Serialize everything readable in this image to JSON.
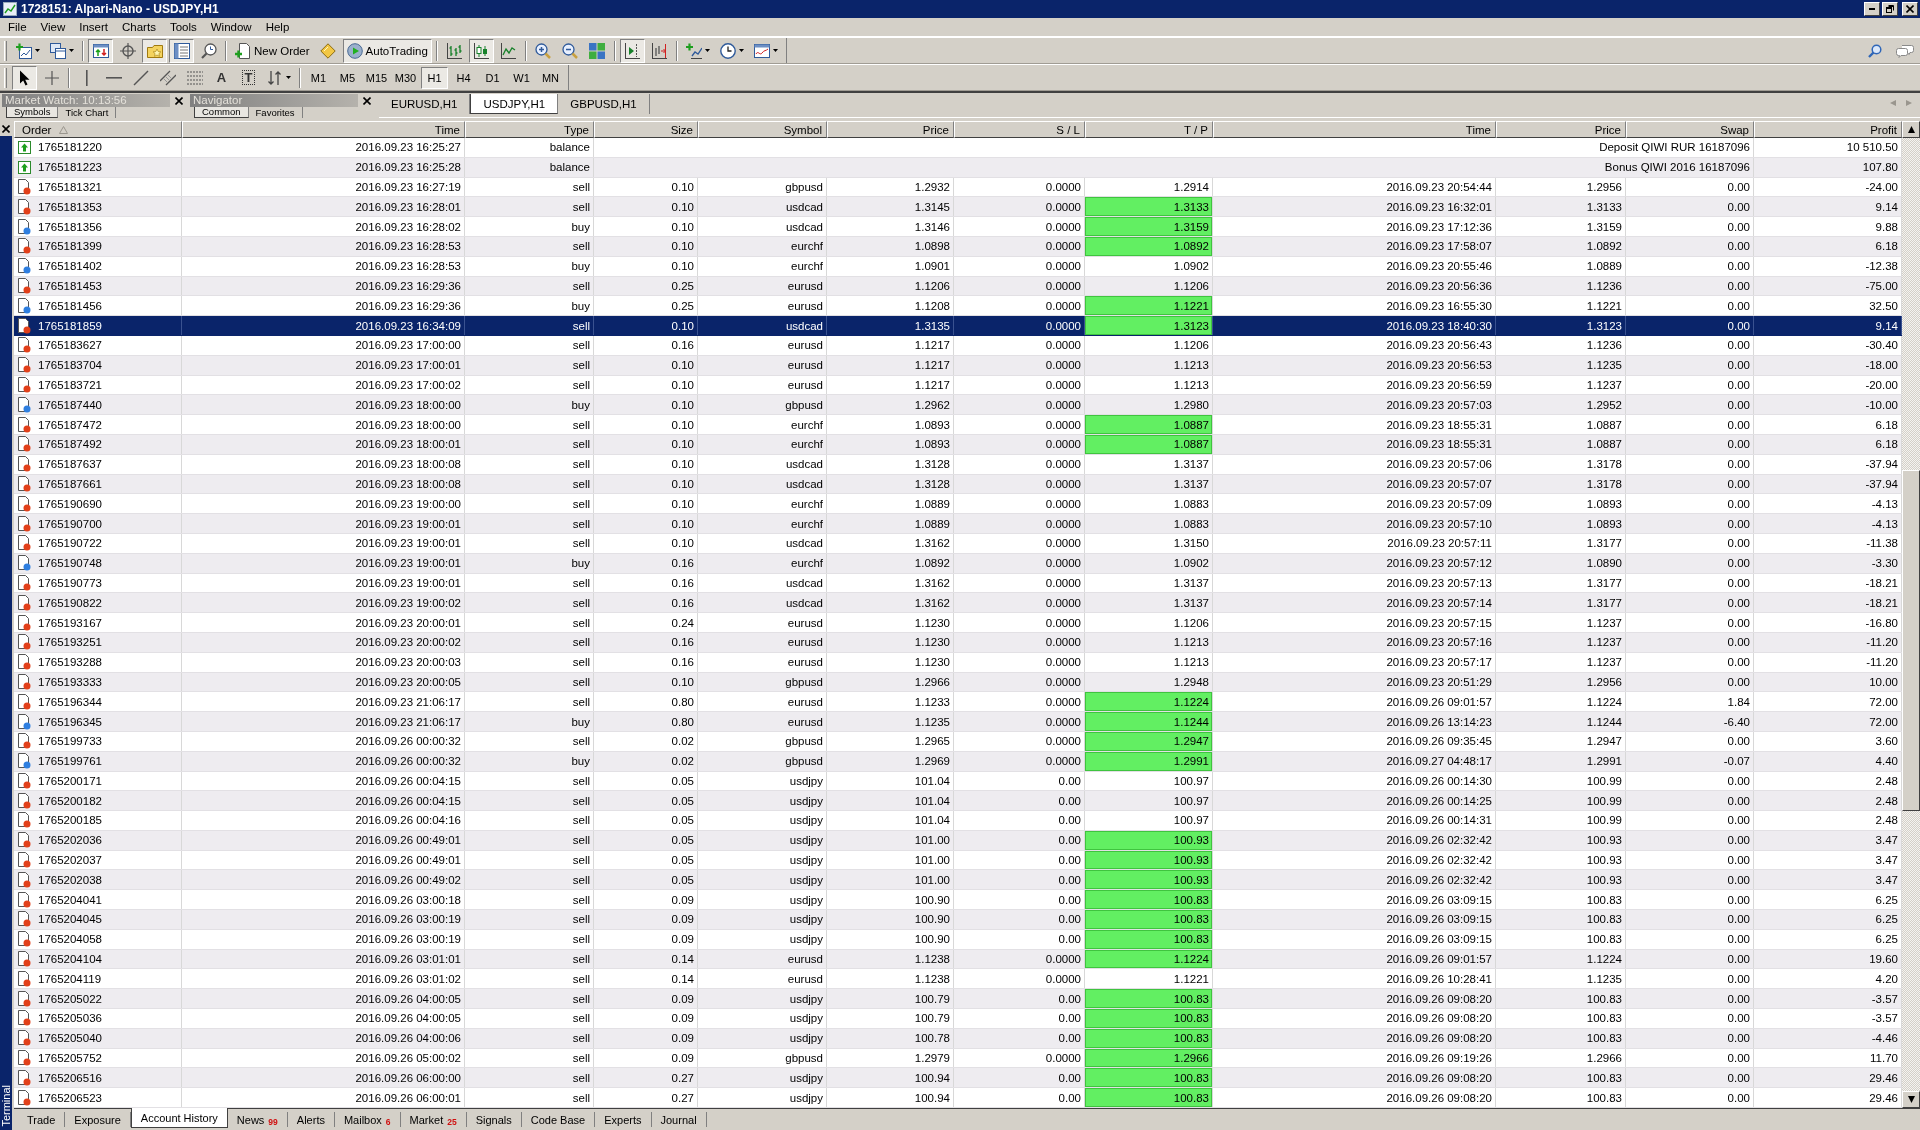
{
  "window": {
    "title": "1728151: Alpari-Nano - USDJPY,H1"
  },
  "menu": [
    "File",
    "View",
    "Insert",
    "Charts",
    "Tools",
    "Window",
    "Help"
  ],
  "toolbar": [
    [
      {
        "kind": "new-chart",
        "pressed": false,
        "dropdown": true
      },
      {
        "kind": "profiles",
        "pressed": false,
        "dropdown": true
      }
    ],
    [
      {
        "kind": "market-watch",
        "pressed": true,
        "dropdown": false
      },
      {
        "kind": "data-window",
        "pressed": false,
        "dropdown": false
      },
      {
        "kind": "navigator",
        "pressed": true,
        "dropdown": false
      },
      {
        "kind": "terminal",
        "pressed": true,
        "dropdown": false
      },
      {
        "kind": "tester",
        "pressed": false,
        "dropdown": false
      }
    ],
    [
      {
        "kind": "new-order",
        "label": "New Order",
        "pressed": false,
        "dropdown": false
      },
      {
        "kind": "editor",
        "pressed": false,
        "dropdown": false
      },
      {
        "kind": "autotrading",
        "label": "AutoTrading",
        "pressed": true,
        "dropdown": false
      }
    ],
    [
      {
        "kind": "bar-chart",
        "pressed": false,
        "dropdown": false
      },
      {
        "kind": "candle-chart",
        "pressed": true,
        "dropdown": false
      },
      {
        "kind": "line-chart",
        "pressed": false,
        "dropdown": false
      }
    ],
    [
      {
        "kind": "zoom-in",
        "pressed": false,
        "dropdown": false
      },
      {
        "kind": "zoom-out",
        "pressed": false,
        "dropdown": false
      },
      {
        "kind": "tile",
        "pressed": false,
        "dropdown": false
      }
    ],
    [
      {
        "kind": "chart-shift",
        "pressed": true,
        "dropdown": false
      },
      {
        "kind": "auto-scroll",
        "pressed": false,
        "dropdown": false
      }
    ],
    [
      {
        "kind": "indicators",
        "pressed": false,
        "dropdown": true
      },
      {
        "kind": "periods",
        "pressed": false,
        "dropdown": true
      },
      {
        "kind": "templates",
        "pressed": false,
        "dropdown": true
      }
    ]
  ],
  "drawing_toolbar": {
    "tools": [
      [
        {
          "kind": "cursor",
          "pressed": true,
          "dropdown": false
        },
        {
          "kind": "crosshair",
          "pressed": false,
          "dropdown": false
        }
      ],
      [
        {
          "kind": "vertical-line",
          "pressed": false,
          "dropdown": false
        },
        {
          "kind": "horizontal-line",
          "pressed": false,
          "dropdown": false
        },
        {
          "kind": "trendline",
          "pressed": false,
          "dropdown": false
        },
        {
          "kind": "channel",
          "pressed": false,
          "dropdown": false
        },
        {
          "kind": "fibonacci",
          "pressed": false,
          "dropdown": false
        },
        {
          "kind": "text",
          "glyph": "A",
          "pressed": false,
          "dropdown": false
        },
        {
          "kind": "label",
          "glyph": "T",
          "pressed": false,
          "dropdown": false
        },
        {
          "kind": "arrows",
          "pressed": false,
          "dropdown": true
        }
      ]
    ],
    "timeframes": [
      {
        "label": "M1",
        "selected": false
      },
      {
        "label": "M5",
        "selected": false
      },
      {
        "label": "M15",
        "selected": false
      },
      {
        "label": "M30",
        "selected": false
      },
      {
        "label": "H1",
        "selected": true
      },
      {
        "label": "H4",
        "selected": false
      },
      {
        "label": "D1",
        "selected": false
      },
      {
        "label": "W1",
        "selected": false
      },
      {
        "label": "MN",
        "selected": false
      }
    ]
  },
  "panels": [
    {
      "title": "Market Watch: 10:13:56",
      "tabs": [
        {
          "label": "Symbols",
          "selected": true
        },
        {
          "label": "Tick Chart",
          "selected": false
        }
      ]
    },
    {
      "title": "Navigator",
      "tabs": [
        {
          "label": "Common",
          "selected": true
        },
        {
          "label": "Favorites",
          "selected": false
        }
      ]
    }
  ],
  "chart_tabs": [
    {
      "label": "EURUSD,H1",
      "selected": false
    },
    {
      "label": "USDJPY,H1",
      "selected": true
    },
    {
      "label": "GBPUSD,H1",
      "selected": false
    }
  ],
  "terminal": {
    "title": "Terminal",
    "columns": [
      {
        "label": "Order",
        "sorted": true
      },
      {
        "label": "Time",
        "sorted": false
      },
      {
        "label": "Type",
        "sorted": false
      },
      {
        "label": "Size",
        "sorted": false
      },
      {
        "label": "Symbol",
        "sorted": false
      },
      {
        "label": "Price",
        "sorted": false
      },
      {
        "label": "S / L",
        "sorted": false
      },
      {
        "label": "T / P",
        "sorted": false
      },
      {
        "label": "Time",
        "sorted": false
      },
      {
        "label": "Price",
        "sorted": false
      },
      {
        "label": "Swap",
        "sorted": false
      },
      {
        "label": "Profit",
        "sorted": false
      }
    ],
    "rows": [
      {
        "kind": "balance",
        "selected": false,
        "cells": [
          "1765181220",
          "2016.09.23 16:25:27",
          "balance",
          "Deposit QIWI RUR 16187096",
          "10 510.50"
        ]
      },
      {
        "kind": "balance",
        "selected": false,
        "cells": [
          "1765181223",
          "2016.09.23 16:25:28",
          "balance",
          "Bonus QIWI 2016 16187096",
          "107.80"
        ]
      },
      {
        "kind": "sell",
        "selected": false,
        "tp_reached": false,
        "cells": [
          "1765181321",
          "2016.09.23 16:27:19",
          "sell",
          "0.10",
          "gbpusd",
          "1.2932",
          "0.0000",
          "1.2914",
          "2016.09.23 20:54:44",
          "1.2956",
          "0.00",
          "-24.00"
        ]
      },
      {
        "kind": "sell",
        "selected": false,
        "tp_reached": true,
        "cells": [
          "1765181353",
          "2016.09.23 16:28:01",
          "sell",
          "0.10",
          "usdcad",
          "1.3145",
          "0.0000",
          "1.3133",
          "2016.09.23 16:32:01",
          "1.3133",
          "0.00",
          "9.14"
        ]
      },
      {
        "kind": "buy",
        "selected": false,
        "tp_reached": true,
        "cells": [
          "1765181356",
          "2016.09.23 16:28:02",
          "buy",
          "0.10",
          "usdcad",
          "1.3146",
          "0.0000",
          "1.3159",
          "2016.09.23 17:12:36",
          "1.3159",
          "0.00",
          "9.88"
        ]
      },
      {
        "kind": "sell",
        "selected": false,
        "tp_reached": true,
        "cells": [
          "1765181399",
          "2016.09.23 16:28:53",
          "sell",
          "0.10",
          "eurchf",
          "1.0898",
          "0.0000",
          "1.0892",
          "2016.09.23 17:58:07",
          "1.0892",
          "0.00",
          "6.18"
        ]
      },
      {
        "kind": "buy",
        "selected": false,
        "tp_reached": false,
        "cells": [
          "1765181402",
          "2016.09.23 16:28:53",
          "buy",
          "0.10",
          "eurchf",
          "1.0901",
          "0.0000",
          "1.0902",
          "2016.09.23 20:55:46",
          "1.0889",
          "0.00",
          "-12.38"
        ]
      },
      {
        "kind": "sell",
        "selected": false,
        "tp_reached": false,
        "cells": [
          "1765181453",
          "2016.09.23 16:29:36",
          "sell",
          "0.25",
          "eurusd",
          "1.1206",
          "0.0000",
          "1.1206",
          "2016.09.23 20:56:36",
          "1.1236",
          "0.00",
          "-75.00"
        ]
      },
      {
        "kind": "buy",
        "selected": false,
        "tp_reached": true,
        "cells": [
          "1765181456",
          "2016.09.23 16:29:36",
          "buy",
          "0.25",
          "eurusd",
          "1.1208",
          "0.0000",
          "1.1221",
          "2016.09.23 16:55:30",
          "1.1221",
          "0.00",
          "32.50"
        ]
      },
      {
        "kind": "sell",
        "selected": true,
        "tp_reached": true,
        "cells": [
          "1765181859",
          "2016.09.23 16:34:09",
          "sell",
          "0.10",
          "usdcad",
          "1.3135",
          "0.0000",
          "1.3123",
          "2016.09.23 18:40:30",
          "1.3123",
          "0.00",
          "9.14"
        ]
      },
      {
        "kind": "sell",
        "selected": false,
        "tp_reached": false,
        "cells": [
          "1765183627",
          "2016.09.23 17:00:00",
          "sell",
          "0.16",
          "eurusd",
          "1.1217",
          "0.0000",
          "1.1206",
          "2016.09.23 20:56:43",
          "1.1236",
          "0.00",
          "-30.40"
        ]
      },
      {
        "kind": "sell",
        "selected": false,
        "tp_reached": false,
        "cells": [
          "1765183704",
          "2016.09.23 17:00:01",
          "sell",
          "0.10",
          "eurusd",
          "1.1217",
          "0.0000",
          "1.1213",
          "2016.09.23 20:56:53",
          "1.1235",
          "0.00",
          "-18.00"
        ]
      },
      {
        "kind": "sell",
        "selected": false,
        "tp_reached": false,
        "cells": [
          "1765183721",
          "2016.09.23 17:00:02",
          "sell",
          "0.10",
          "eurusd",
          "1.1217",
          "0.0000",
          "1.1213",
          "2016.09.23 20:56:59",
          "1.1237",
          "0.00",
          "-20.00"
        ]
      },
      {
        "kind": "buy",
        "selected": false,
        "tp_reached": false,
        "cells": [
          "1765187440",
          "2016.09.23 18:00:00",
          "buy",
          "0.10",
          "gbpusd",
          "1.2962",
          "0.0000",
          "1.2980",
          "2016.09.23 20:57:03",
          "1.2952",
          "0.00",
          "-10.00"
        ]
      },
      {
        "kind": "sell",
        "selected": false,
        "tp_reached": true,
        "cells": [
          "1765187472",
          "2016.09.23 18:00:00",
          "sell",
          "0.10",
          "eurchf",
          "1.0893",
          "0.0000",
          "1.0887",
          "2016.09.23 18:55:31",
          "1.0887",
          "0.00",
          "6.18"
        ]
      },
      {
        "kind": "sell",
        "selected": false,
        "tp_reached": true,
        "cells": [
          "1765187492",
          "2016.09.23 18:00:01",
          "sell",
          "0.10",
          "eurchf",
          "1.0893",
          "0.0000",
          "1.0887",
          "2016.09.23 18:55:31",
          "1.0887",
          "0.00",
          "6.18"
        ]
      },
      {
        "kind": "sell",
        "selected": false,
        "tp_reached": false,
        "cells": [
          "1765187637",
          "2016.09.23 18:00:08",
          "sell",
          "0.10",
          "usdcad",
          "1.3128",
          "0.0000",
          "1.3137",
          "2016.09.23 20:57:06",
          "1.3178",
          "0.00",
          "-37.94"
        ]
      },
      {
        "kind": "sell",
        "selected": false,
        "tp_reached": false,
        "cells": [
          "1765187661",
          "2016.09.23 18:00:08",
          "sell",
          "0.10",
          "usdcad",
          "1.3128",
          "0.0000",
          "1.3137",
          "2016.09.23 20:57:07",
          "1.3178",
          "0.00",
          "-37.94"
        ]
      },
      {
        "kind": "sell",
        "selected": false,
        "tp_reached": false,
        "cells": [
          "1765190690",
          "2016.09.23 19:00:00",
          "sell",
          "0.10",
          "eurchf",
          "1.0889",
          "0.0000",
          "1.0883",
          "2016.09.23 20:57:09",
          "1.0893",
          "0.00",
          "-4.13"
        ]
      },
      {
        "kind": "sell",
        "selected": false,
        "tp_reached": false,
        "cells": [
          "1765190700",
          "2016.09.23 19:00:01",
          "sell",
          "0.10",
          "eurchf",
          "1.0889",
          "0.0000",
          "1.0883",
          "2016.09.23 20:57:10",
          "1.0893",
          "0.00",
          "-4.13"
        ]
      },
      {
        "kind": "sell",
        "selected": false,
        "tp_reached": false,
        "cells": [
          "1765190722",
          "2016.09.23 19:00:01",
          "sell",
          "0.10",
          "usdcad",
          "1.3162",
          "0.0000",
          "1.3150",
          "2016.09.23 20:57:11",
          "1.3177",
          "0.00",
          "-11.38"
        ]
      },
      {
        "kind": "buy",
        "selected": false,
        "tp_reached": false,
        "cells": [
          "1765190748",
          "2016.09.23 19:00:01",
          "buy",
          "0.16",
          "eurchf",
          "1.0892",
          "0.0000",
          "1.0902",
          "2016.09.23 20:57:12",
          "1.0890",
          "0.00",
          "-3.30"
        ]
      },
      {
        "kind": "sell",
        "selected": false,
        "tp_reached": false,
        "cells": [
          "1765190773",
          "2016.09.23 19:00:01",
          "sell",
          "0.16",
          "usdcad",
          "1.3162",
          "0.0000",
          "1.3137",
          "2016.09.23 20:57:13",
          "1.3177",
          "0.00",
          "-18.21"
        ]
      },
      {
        "kind": "sell",
        "selected": false,
        "tp_reached": false,
        "cells": [
          "1765190822",
          "2016.09.23 19:00:02",
          "sell",
          "0.16",
          "usdcad",
          "1.3162",
          "0.0000",
          "1.3137",
          "2016.09.23 20:57:14",
          "1.3177",
          "0.00",
          "-18.21"
        ]
      },
      {
        "kind": "sell",
        "selected": false,
        "tp_reached": false,
        "cells": [
          "1765193167",
          "2016.09.23 20:00:01",
          "sell",
          "0.24",
          "eurusd",
          "1.1230",
          "0.0000",
          "1.1206",
          "2016.09.23 20:57:15",
          "1.1237",
          "0.00",
          "-16.80"
        ]
      },
      {
        "kind": "sell",
        "selected": false,
        "tp_reached": false,
        "cells": [
          "1765193251",
          "2016.09.23 20:00:02",
          "sell",
          "0.16",
          "eurusd",
          "1.1230",
          "0.0000",
          "1.1213",
          "2016.09.23 20:57:16",
          "1.1237",
          "0.00",
          "-11.20"
        ]
      },
      {
        "kind": "sell",
        "selected": false,
        "tp_reached": false,
        "cells": [
          "1765193288",
          "2016.09.23 20:00:03",
          "sell",
          "0.16",
          "eurusd",
          "1.1230",
          "0.0000",
          "1.1213",
          "2016.09.23 20:57:17",
          "1.1237",
          "0.00",
          "-11.20"
        ]
      },
      {
        "kind": "sell",
        "selected": false,
        "tp_reached": false,
        "cells": [
          "1765193333",
          "2016.09.23 20:00:05",
          "sell",
          "0.10",
          "gbpusd",
          "1.2966",
          "0.0000",
          "1.2948",
          "2016.09.23 20:51:29",
          "1.2956",
          "0.00",
          "10.00"
        ]
      },
      {
        "kind": "sell",
        "selected": false,
        "tp_reached": true,
        "cells": [
          "1765196344",
          "2016.09.23 21:06:17",
          "sell",
          "0.80",
          "eurusd",
          "1.1233",
          "0.0000",
          "1.1224",
          "2016.09.26 09:01:57",
          "1.1224",
          "1.84",
          "72.00"
        ]
      },
      {
        "kind": "buy",
        "selected": false,
        "tp_reached": true,
        "cells": [
          "1765196345",
          "2016.09.23 21:06:17",
          "buy",
          "0.80",
          "eurusd",
          "1.1235",
          "0.0000",
          "1.1244",
          "2016.09.26 13:14:23",
          "1.1244",
          "-6.40",
          "72.00"
        ]
      },
      {
        "kind": "sell",
        "selected": false,
        "tp_reached": true,
        "cells": [
          "1765199733",
          "2016.09.26 00:00:32",
          "sell",
          "0.02",
          "gbpusd",
          "1.2965",
          "0.0000",
          "1.2947",
          "2016.09.26 09:35:45",
          "1.2947",
          "0.00",
          "3.60"
        ]
      },
      {
        "kind": "buy",
        "selected": false,
        "tp_reached": true,
        "cells": [
          "1765199761",
          "2016.09.26 00:00:32",
          "buy",
          "0.02",
          "gbpusd",
          "1.2969",
          "0.0000",
          "1.2991",
          "2016.09.27 04:48:17",
          "1.2991",
          "-0.07",
          "4.40"
        ]
      },
      {
        "kind": "sell",
        "selected": false,
        "tp_reached": false,
        "cells": [
          "1765200171",
          "2016.09.26 00:04:15",
          "sell",
          "0.05",
          "usdjpy",
          "101.04",
          "0.00",
          "100.97",
          "2016.09.26 00:14:30",
          "100.99",
          "0.00",
          "2.48"
        ]
      },
      {
        "kind": "sell",
        "selected": false,
        "tp_reached": false,
        "cells": [
          "1765200182",
          "2016.09.26 00:04:15",
          "sell",
          "0.05",
          "usdjpy",
          "101.04",
          "0.00",
          "100.97",
          "2016.09.26 00:14:25",
          "100.99",
          "0.00",
          "2.48"
        ]
      },
      {
        "kind": "sell",
        "selected": false,
        "tp_reached": false,
        "cells": [
          "1765200185",
          "2016.09.26 00:04:16",
          "sell",
          "0.05",
          "usdjpy",
          "101.04",
          "0.00",
          "100.97",
          "2016.09.26 00:14:31",
          "100.99",
          "0.00",
          "2.48"
        ]
      },
      {
        "kind": "sell",
        "selected": false,
        "tp_reached": true,
        "cells": [
          "1765202036",
          "2016.09.26 00:49:01",
          "sell",
          "0.05",
          "usdjpy",
          "101.00",
          "0.00",
          "100.93",
          "2016.09.26 02:32:42",
          "100.93",
          "0.00",
          "3.47"
        ]
      },
      {
        "kind": "sell",
        "selected": false,
        "tp_reached": true,
        "cells": [
          "1765202037",
          "2016.09.26 00:49:01",
          "sell",
          "0.05",
          "usdjpy",
          "101.00",
          "0.00",
          "100.93",
          "2016.09.26 02:32:42",
          "100.93",
          "0.00",
          "3.47"
        ]
      },
      {
        "kind": "sell",
        "selected": false,
        "tp_reached": true,
        "cells": [
          "1765202038",
          "2016.09.26 00:49:02",
          "sell",
          "0.05",
          "usdjpy",
          "101.00",
          "0.00",
          "100.93",
          "2016.09.26 02:32:42",
          "100.93",
          "0.00",
          "3.47"
        ]
      },
      {
        "kind": "sell",
        "selected": false,
        "tp_reached": true,
        "cells": [
          "1765204041",
          "2016.09.26 03:00:18",
          "sell",
          "0.09",
          "usdjpy",
          "100.90",
          "0.00",
          "100.83",
          "2016.09.26 03:09:15",
          "100.83",
          "0.00",
          "6.25"
        ]
      },
      {
        "kind": "sell",
        "selected": false,
        "tp_reached": true,
        "cells": [
          "1765204045",
          "2016.09.26 03:00:19",
          "sell",
          "0.09",
          "usdjpy",
          "100.90",
          "0.00",
          "100.83",
          "2016.09.26 03:09:15",
          "100.83",
          "0.00",
          "6.25"
        ]
      },
      {
        "kind": "sell",
        "selected": false,
        "tp_reached": true,
        "cells": [
          "1765204058",
          "2016.09.26 03:00:19",
          "sell",
          "0.09",
          "usdjpy",
          "100.90",
          "0.00",
          "100.83",
          "2016.09.26 03:09:15",
          "100.83",
          "0.00",
          "6.25"
        ]
      },
      {
        "kind": "sell",
        "selected": false,
        "tp_reached": true,
        "cells": [
          "1765204104",
          "2016.09.26 03:01:01",
          "sell",
          "0.14",
          "eurusd",
          "1.1238",
          "0.0000",
          "1.1224",
          "2016.09.26 09:01:57",
          "1.1224",
          "0.00",
          "19.60"
        ]
      },
      {
        "kind": "sell",
        "selected": false,
        "tp_reached": false,
        "cells": [
          "1765204119",
          "2016.09.26 03:01:02",
          "sell",
          "0.14",
          "eurusd",
          "1.1238",
          "0.0000",
          "1.1221",
          "2016.09.26 10:28:41",
          "1.1235",
          "0.00",
          "4.20"
        ]
      },
      {
        "kind": "sell",
        "selected": false,
        "tp_reached": true,
        "cells": [
          "1765205022",
          "2016.09.26 04:00:05",
          "sell",
          "0.09",
          "usdjpy",
          "100.79",
          "0.00",
          "100.83",
          "2016.09.26 09:08:20",
          "100.83",
          "0.00",
          "-3.57"
        ]
      },
      {
        "kind": "sell",
        "selected": false,
        "tp_reached": true,
        "cells": [
          "1765205036",
          "2016.09.26 04:00:05",
          "sell",
          "0.09",
          "usdjpy",
          "100.79",
          "0.00",
          "100.83",
          "2016.09.26 09:08:20",
          "100.83",
          "0.00",
          "-3.57"
        ]
      },
      {
        "kind": "sell",
        "selected": false,
        "tp_reached": true,
        "cells": [
          "1765205040",
          "2016.09.26 04:00:06",
          "sell",
          "0.09",
          "usdjpy",
          "100.78",
          "0.00",
          "100.83",
          "2016.09.26 09:08:20",
          "100.83",
          "0.00",
          "-4.46"
        ]
      },
      {
        "kind": "sell",
        "selected": false,
        "tp_reached": true,
        "cells": [
          "1765205752",
          "2016.09.26 05:00:02",
          "sell",
          "0.09",
          "gbpusd",
          "1.2979",
          "0.0000",
          "1.2966",
          "2016.09.26 09:19:26",
          "1.2966",
          "0.00",
          "11.70"
        ]
      },
      {
        "kind": "sell",
        "selected": false,
        "tp_reached": true,
        "cells": [
          "1765206516",
          "2016.09.26 06:00:00",
          "sell",
          "0.27",
          "usdjpy",
          "100.94",
          "0.00",
          "100.83",
          "2016.09.26 09:08:20",
          "100.83",
          "0.00",
          "29.46"
        ]
      },
      {
        "kind": "sell",
        "selected": false,
        "tp_reached": true,
        "cells": [
          "1765206523",
          "2016.09.26 06:00:01",
          "sell",
          "0.27",
          "usdjpy",
          "100.94",
          "0.00",
          "100.83",
          "2016.09.26 09:08:20",
          "100.83",
          "0.00",
          "29.46"
        ]
      }
    ],
    "tabs": [
      {
        "label": "Trade",
        "selected": false
      },
      {
        "label": "Exposure",
        "selected": false
      },
      {
        "label": "Account History",
        "selected": true
      },
      {
        "label": "News",
        "badge": "99",
        "selected": false
      },
      {
        "label": "Alerts",
        "selected": false
      },
      {
        "label": "Mailbox",
        "badge": "6",
        "selected": false
      },
      {
        "label": "Market",
        "badge": "25",
        "selected": false
      },
      {
        "label": "Signals",
        "selected": false
      },
      {
        "label": "Code Base",
        "selected": false
      },
      {
        "label": "Experts",
        "selected": false
      },
      {
        "label": "Journal",
        "selected": false
      }
    ]
  }
}
